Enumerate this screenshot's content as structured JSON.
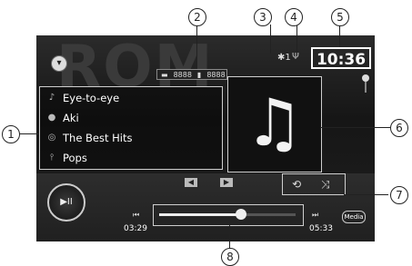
{
  "source": {
    "watermark": "ROM",
    "icon": "chevron-down-icon"
  },
  "counters": {
    "folder_count": "8888",
    "file_count": "8888"
  },
  "status": {
    "bluetooth": "1",
    "clock": "10:36"
  },
  "track": {
    "title": "Eye-to-eye",
    "artist": "Aki",
    "album": "The Best Hits",
    "genre": "Pops"
  },
  "playback": {
    "elapsed": "03:29",
    "remaining": "05:33",
    "progress": 0.6
  },
  "media_label": "Media",
  "callouts": [
    "1",
    "2",
    "3",
    "4",
    "5",
    "6",
    "7",
    "8"
  ]
}
